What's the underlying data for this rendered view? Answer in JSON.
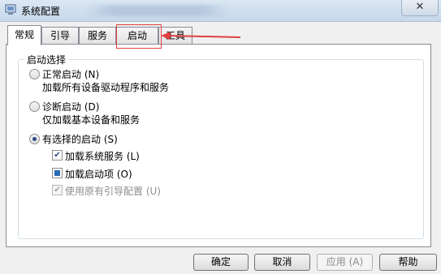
{
  "window": {
    "title": "系统配置",
    "close_glyph": "✕"
  },
  "tabs": [
    {
      "label": "常规",
      "active": true
    },
    {
      "label": "引导",
      "active": false
    },
    {
      "label": "服务",
      "active": false
    },
    {
      "label": "启动",
      "active": false
    },
    {
      "label": "工具",
      "active": false
    }
  ],
  "startup_selection": {
    "group_label": "启动选择",
    "normal": {
      "label": "正常启动 (N)",
      "desc": "加载所有设备驱动程序和服务",
      "selected": false
    },
    "diagnostic": {
      "label": "诊断启动 (D)",
      "desc": "仅加载基本设备和服务",
      "selected": false
    },
    "selective": {
      "label": "有选择的启动 (S)",
      "selected": true
    },
    "options": {
      "load_services": {
        "label": "加载系统服务 (L)",
        "state": "checked"
      },
      "load_startup": {
        "label": "加载启动项 (O)",
        "state": "indeterminate"
      },
      "use_boot_config": {
        "label": "使用原有引导配置 (U)",
        "state": "checked-disabled"
      }
    }
  },
  "buttons": {
    "ok": "确定",
    "cancel": "取消",
    "apply": "应用 (A)",
    "help": "帮助"
  },
  "colors": {
    "annotation": "#e04040",
    "accent": "#2a6ab8"
  },
  "icons": {
    "window": "msconfig-icon",
    "close": "close-icon"
  }
}
